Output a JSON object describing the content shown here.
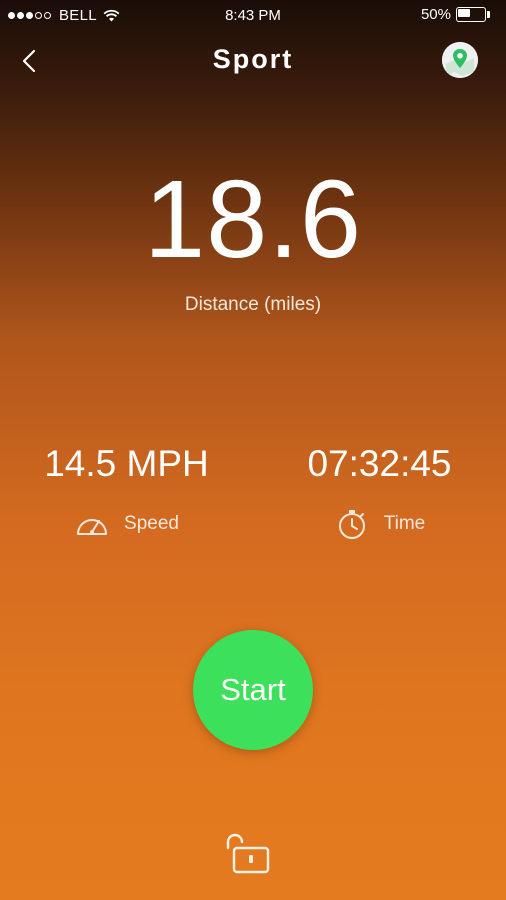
{
  "status_bar": {
    "carrier": "BELL",
    "time": "8:43 PM",
    "battery_percent": "50%",
    "battery_level": 0.5,
    "signal_bars_filled": 3,
    "signal_bars_total": 5
  },
  "nav": {
    "title": "Sport",
    "back_icon": "chevron-left-icon",
    "map_icon": "map-pin-icon"
  },
  "distance": {
    "value": "18.6",
    "label": "Distance (miles)"
  },
  "stats": {
    "speed": {
      "value": "14.5 MPH",
      "label": "Speed",
      "icon": "speedometer-icon"
    },
    "time": {
      "value": "07:32:45",
      "label": "Time",
      "icon": "stopwatch-icon"
    }
  },
  "start_button": {
    "label": "Start"
  },
  "lock": {
    "icon": "unlock-icon"
  },
  "colors": {
    "start_green": "#3de05a",
    "gradient_top": "#1a0d07",
    "gradient_bottom": "#e57b1f",
    "map_pin_green": "#2fbf63"
  }
}
